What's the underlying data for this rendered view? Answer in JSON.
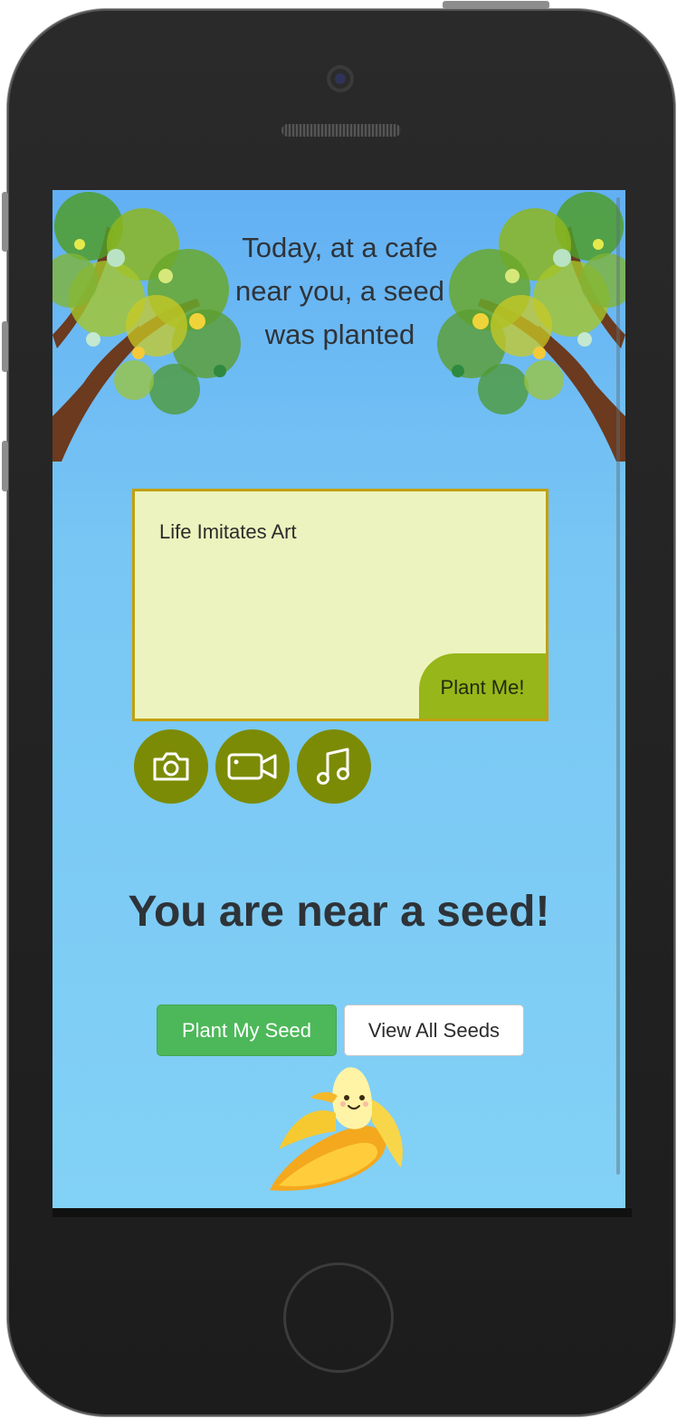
{
  "headline": "Today, at a cafe near you, a seed was planted",
  "note": {
    "text": "Life Imitates Art",
    "plant_button": "Plant Me!"
  },
  "media_buttons": [
    {
      "icon": "camera-icon"
    },
    {
      "icon": "video-camera-icon"
    },
    {
      "icon": "music-note-icon"
    }
  ],
  "status_message": "You are near a seed!",
  "actions": {
    "plant_my_seed": "Plant My Seed",
    "view_all_seeds": "View All Seeds"
  },
  "colors": {
    "sky_top": "#62b0f3",
    "sky_bottom": "#82d1f6",
    "note_bg": "#edf3be",
    "note_border": "#c3a00c",
    "plant_me_bg": "#97b61a",
    "media_btn": "#7c8b05",
    "primary_green": "#4db85a"
  }
}
